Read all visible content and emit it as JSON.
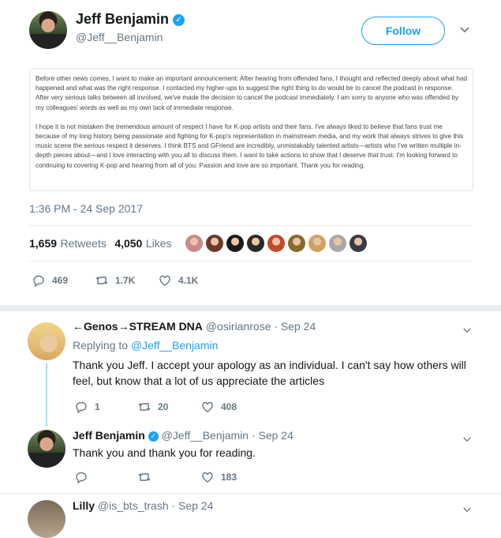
{
  "main_tweet": {
    "author_name": "Jeff Benjamin",
    "author_handle": "@Jeff__Benjamin",
    "follow_label": "Follow",
    "image_paragraphs": [
      "Before other news comes, I want to make an important announcement: After hearing from offended fans, I thought and reflected deeply about what had happened and what was the right response. I contacted my higher-ups to suggest the right thing to do would be to cancel the podcast in response. After very serious talks between all involved, we've made the decision to cancel the podcast immediately. I am sorry to anyone who was offended by my colleagues' words as well as my own lack of immediate response.",
      "I hope it is not mistaken the tremendous amount of respect I have for K-pop artists and their fans. I've always liked to believe that fans trust me because of my long history being passionate and fighting for K-pop's representation in mainstream media, and my work that always strives to give this music scene the serious respect it deserves. I think BTS and GFriend are incredibly, unmistakably talented artists—artists who I've written multiple in-depth pieces about—and I love interacting with you all to discuss them. I want to take actions to show that I deserve that trust. I'm looking forward to continuing to covering K-pop and hearing from all of you. Passion and love are so important. Thank you for reading."
    ],
    "timestamp": "1:36 PM - 24 Sep 2017",
    "retweets_count": "1,659",
    "retweets_label": "Retweets",
    "likes_count": "4,050",
    "likes_label": "Likes",
    "reply_count": "469",
    "retweet_action_count": "1.7K",
    "like_action_count": "4.1K",
    "liker_avatar_colors": [
      "#c88a8a",
      "#6b3a2a",
      "#1c1c1c",
      "#2a2a2a",
      "#c24a2a",
      "#8a6a2a",
      "#d4a060",
      "#a8a8a8",
      "#3a3a48"
    ]
  },
  "replies": [
    {
      "name": "←Genos→STREAM DNA",
      "handle": "@osirianrose",
      "date": "· Sep 24",
      "replying_prefix": "Replying to",
      "replying_to": "@Jeff__Benjamin",
      "text": "Thank you Jeff. I accept your apology as an individual. I can't say how others will feel, but know that a lot of us appreciate the articles",
      "reply_count": "1",
      "retweet_count": "20",
      "like_count": "408"
    },
    {
      "name": "Jeff Benjamin",
      "handle": "@Jeff__Benjamin",
      "date": "· Sep 24",
      "text": "Thank you and thank you for reading.",
      "like_count": "183"
    },
    {
      "name": "Lilly",
      "handle": "@is_bts_trash",
      "date": "· Sep 24"
    }
  ],
  "colors": {
    "accent": "#1da1f2",
    "muted": "#657786",
    "border": "#e6ecf0",
    "thread": "#a3e0e6"
  }
}
